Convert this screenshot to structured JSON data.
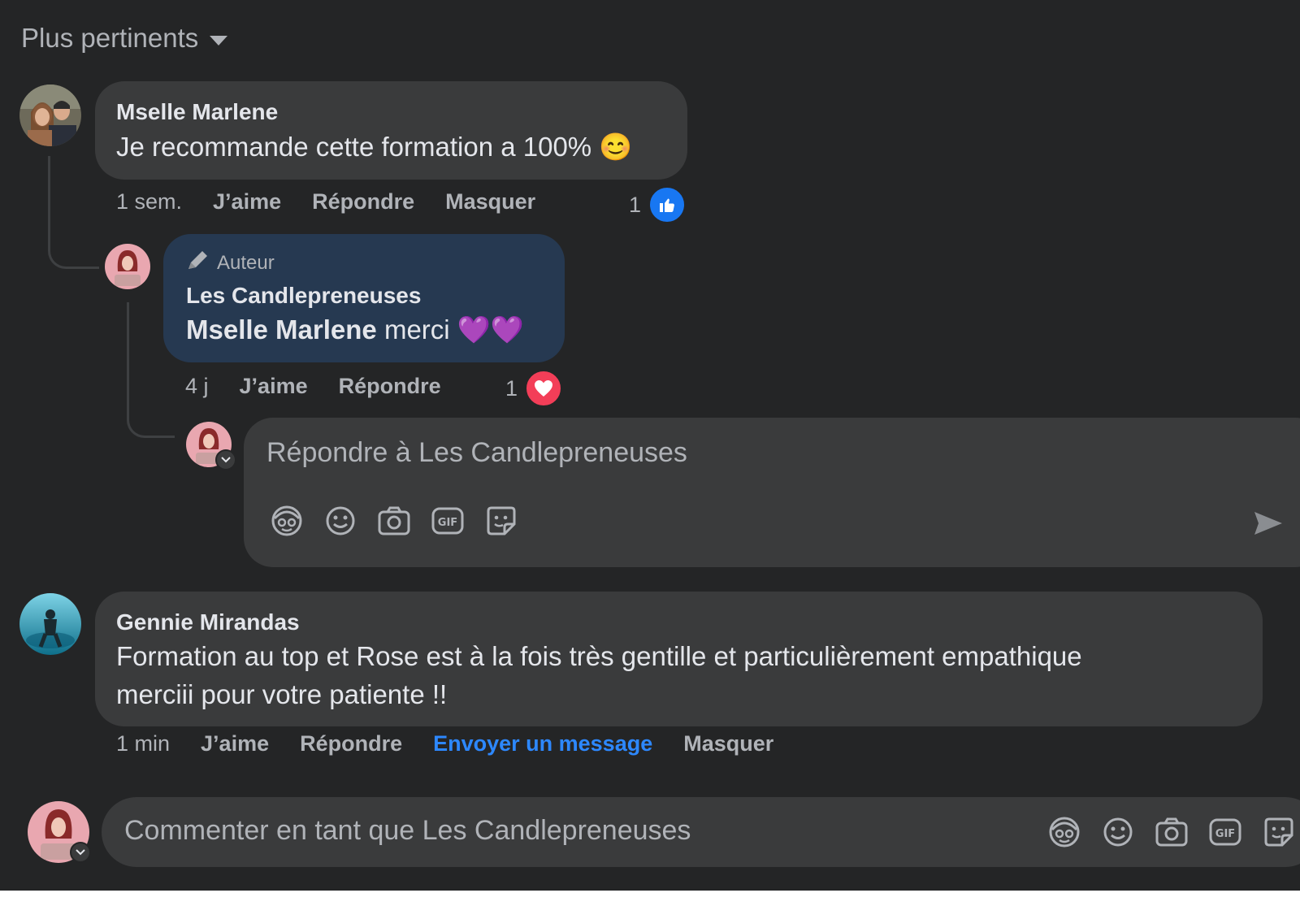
{
  "sort": {
    "label": "Plus pertinents"
  },
  "comments": [
    {
      "author": "Mselle Marlene",
      "text": "Je recommande cette formation a 100% 😊",
      "time": "1 sem.",
      "like_label": "J’aime",
      "reply_label": "Répondre",
      "hide_label": "Masquer",
      "reaction_count": "1",
      "replies": [
        {
          "badge": "Auteur",
          "author": "Les Candlepreneuses",
          "mention": "Mselle Marlene",
          "text": " merci 💜💜",
          "time": "4 j",
          "like_label": "J’aime",
          "reply_label": "Répondre",
          "reaction_count": "1"
        }
      ],
      "reply_composer": {
        "placeholder": "Répondre à Les Candlepreneuses"
      }
    },
    {
      "author": "Gennie Mirandas",
      "text_line1": "Formation au top et Rose est à la fois très gentille et particulièrement empathique",
      "text_line2": "merciii pour votre patiente !!",
      "time": "1 min",
      "like_label": "J’aime",
      "reply_label": "Répondre",
      "message_label": "Envoyer un message",
      "hide_label": "Masquer"
    }
  ],
  "main_composer": {
    "placeholder": "Commenter en tant que Les Candlepreneuses"
  },
  "colors": {
    "background": "#242526",
    "bubble": "#3a3b3c",
    "author_bubble": "#263951",
    "link": "#2d88ff",
    "like": "#1877f2",
    "love": "#f33e58"
  },
  "icons": [
    "avatar-sticker-icon",
    "emoji-icon",
    "camera-icon",
    "gif-icon",
    "sticker-icon",
    "send-icon",
    "chevron-down-icon",
    "like-reaction-icon",
    "love-reaction-icon",
    "pencil-icon"
  ]
}
